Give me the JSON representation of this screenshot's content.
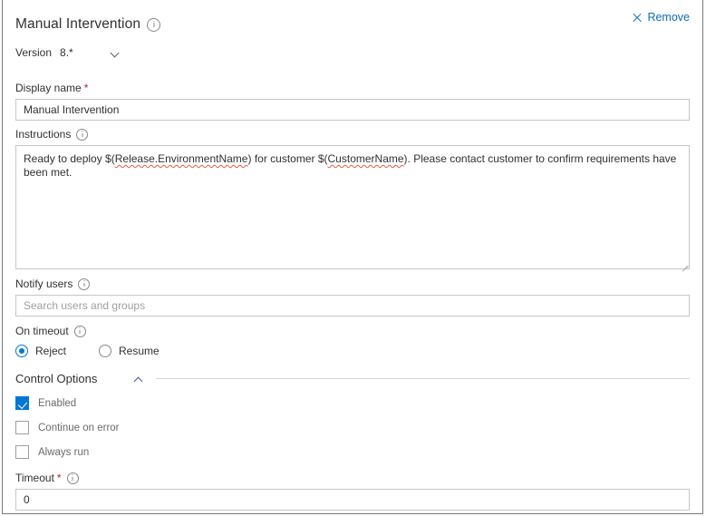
{
  "header": {
    "title": "Manual Intervention",
    "info_icon": "info-icon",
    "remove_label": "Remove",
    "remove_icon": "close-x-icon"
  },
  "version": {
    "label": "Version",
    "value": "8.*",
    "chevron_icon": "chevron-down-icon"
  },
  "display_name": {
    "label": "Display name",
    "required_marker": "*",
    "value": "Manual Intervention",
    "placeholder": ""
  },
  "instructions": {
    "label": "Instructions",
    "info_icon": "info-icon",
    "text_parts": [
      {
        "text": "Ready to deploy $(",
        "spell_error": false
      },
      {
        "text": "Release.EnvironmentName",
        "spell_error": true
      },
      {
        "text": ") for customer $(",
        "spell_error": false
      },
      {
        "text": "CustomerName",
        "spell_error": true
      },
      {
        "text": "). Please contact customer to confirm requirements have been met.",
        "spell_error": false
      }
    ],
    "full_text": "Ready to deploy $(Release.EnvironmentName) for customer $(CustomerName). Please contact customer to confirm requirements have been met.",
    "resize_handle_icon": "resize-grip-icon"
  },
  "notify_users": {
    "label": "Notify users",
    "info_icon": "info-icon",
    "value": "",
    "placeholder": "Search users and groups"
  },
  "on_timeout": {
    "label": "On timeout",
    "info_icon": "info-icon",
    "options": [
      {
        "label": "Reject",
        "checked": true
      },
      {
        "label": "Resume",
        "checked": false
      }
    ]
  },
  "control_options": {
    "title": "Control Options",
    "collapse_icon": "chevron-up-icon",
    "expanded": true,
    "checkboxes": [
      {
        "label": "Enabled",
        "checked": true
      },
      {
        "label": "Continue on error",
        "checked": false
      },
      {
        "label": "Always run",
        "checked": false
      }
    ]
  },
  "timeout": {
    "label": "Timeout",
    "required_marker": "*",
    "info_icon": "info-icon",
    "value": "0",
    "placeholder": ""
  },
  "colors": {
    "accent": "#0078d4",
    "link": "#0f6cbd",
    "required": "#a4262c",
    "text": "#323130",
    "border": "#c8c6c4",
    "spell_error": "#e05c4b"
  }
}
